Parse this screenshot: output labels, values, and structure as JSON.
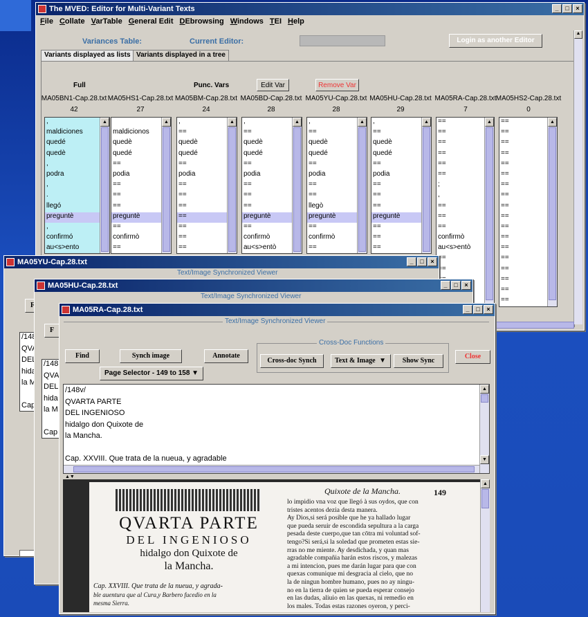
{
  "main_window": {
    "title": "The MVED: Editor for Multi-Variant Texts",
    "menu": [
      "File",
      "Collate",
      "VarTable",
      "General Edit",
      "DEbrowsing",
      "Windows",
      "TEI",
      "Help"
    ],
    "variances_label": "Variances Table:",
    "current_editor_label": "Current Editor:",
    "login_button": "Login as another Editor",
    "tabs": [
      "Variants displayed as lists",
      "Variants displayed in a tree"
    ],
    "full_label": "Full",
    "punc_label": "Punc. Vars",
    "edit_var_button": "Edit Var",
    "remove_var_button": "Remove Var",
    "columns": [
      {
        "file": "MA05BN1-Cap.28.txt",
        "count": "42"
      },
      {
        "file": "MA05HS1-Cap.28.txt",
        "count": "27"
      },
      {
        "file": "MA05BM-Cap.28.txt",
        "count": "24"
      },
      {
        "file": "MA05BD-Cap.28.txt",
        "count": "28"
      },
      {
        "file": "MA05YU-Cap.28.txt",
        "count": "28"
      },
      {
        "file": "MA05HU-Cap.28.txt",
        "count": "29"
      },
      {
        "file": "MA05RA-Cap.28.txt",
        "count": "7"
      },
      {
        "file": "MA05HS2-Cap.28.txt",
        "count": "0"
      }
    ],
    "lists": [
      [
        ",",
        "maldiciones",
        "quedé",
        "quedè",
        ",",
        "podra",
        ",",
        ".",
        "llegó",
        "preguntè",
        ",",
        "confirmó",
        "au<s>ento"
      ],
      [
        "",
        "maldicionos",
        "quedè",
        "quedé",
        "==",
        "podia",
        "==",
        "==",
        "==",
        "preguntè",
        "==",
        "confirmò",
        "=="
      ],
      [
        ",",
        "==",
        "quedè",
        "quedé",
        "==",
        "podia",
        "==",
        "==",
        "==",
        "==",
        "==",
        "==",
        "=="
      ],
      [
        ",",
        "==",
        "quedè",
        "quedé",
        "==",
        "podia",
        "==",
        "==",
        "==",
        "preguntè",
        "==",
        "confirmò",
        "au<s>entò"
      ],
      [
        ",",
        "==",
        "quedè",
        "quedé",
        "==",
        "podia",
        "==",
        "==",
        "llegò",
        "preguntè",
        "==",
        "confirmò",
        "=="
      ],
      [
        ",",
        "==",
        "quedè",
        "quedé",
        "==",
        "podia",
        "==",
        "==",
        "==",
        "preguntè",
        "==",
        "==",
        "=="
      ],
      [
        "==",
        "==",
        "==",
        "==",
        "==",
        "==",
        ";",
        ",",
        "==",
        "==",
        "==",
        "confirmò",
        "au<s>entò",
        "==",
        "==",
        "==",
        "==",
        "=="
      ],
      [
        "==",
        "==",
        "==",
        "==",
        "==",
        "==",
        "==",
        "==",
        "==",
        "==",
        "==",
        "==",
        "==",
        "==",
        "==",
        "==",
        "==",
        "=="
      ]
    ]
  },
  "viewer_yu": {
    "title": "MA05YU-Cap.28.txt",
    "header": "Text/Image Synchronized Viewer",
    "lines": [
      "/148",
      "QVA",
      "DEL",
      "hida",
      "la M",
      "",
      "Cap"
    ]
  },
  "viewer_hu": {
    "title": "MA05HU-Cap.28.txt",
    "header": "Text/Image Synchronized Viewer",
    "lines": [
      "/148",
      "QVA",
      "DEL",
      "hida",
      "la M",
      "",
      "Cap"
    ]
  },
  "viewer_ra": {
    "title": "MA05RA-Cap.28.txt",
    "header": "Text/Image Synchronized Viewer",
    "find_button": "Find",
    "synch_image_button": "Synch image",
    "annotate_button": "Annotate",
    "crossdoc_legend": "Cross-Doc Functions",
    "crossdoc_synch_button": "Cross-doc Synch",
    "text_image_select": "Text & Image",
    "show_sync_button": "Show Sync",
    "close_button": "Close",
    "page_selector": "Page Selector - 149 to 158",
    "text_lines": [
      "/148v/",
      "QVARTA PARTE",
      "DEL INGENIOSO",
      "hidalgo don Quixote de",
      "la Mancha.",
      "",
      "Cap. XXVIII. Que trata de la nueua, y agradable"
    ],
    "book": {
      "left": {
        "title1": "QVARTA PARTE",
        "title2": "DEL INGENIOSO",
        "title3": "hidalgo don Quixote de",
        "title4": "la Mancha.",
        "cap": "Cap. XXVIII. Que trata de la nueua, y agrada-",
        "cap2": "ble auentura que al Cura,y Barbero fucedio en la",
        "cap3": "mesma Sierra."
      },
      "right": {
        "running_head": "Quixote de la Mancha.",
        "page_no": "149",
        "lines": [
          "lo impidio vna voz que llegó à sus oydos, que con",
          "tristes acentos dezia desta manera.",
          "Ay Dios,si será posible que he ya hallado lugar",
          "que pueda seruir de escondida sepultura a la carga",
          "pesada deste cuerpo,que tan cōtra mi voluntad sof-",
          "tengo?Si será,si la soledad que prometen estas sie-",
          "rras no me miente. Ay desdichada, y quan mas",
          "agradable compañia harán estos riscos, y malezas",
          "a mi intencion, pues me darán lugar para que con",
          "quexas comunique mi desgracia al cielo, que no",
          "la de ningun hombre humano, pues no ay ningu-",
          "no en la tierra de quien se pueda esperar consejo",
          "en las dudas, aliuio en las quexas, ni remedio en",
          "los males. Todas estas razones oyeron, y perci-"
        ]
      }
    }
  }
}
